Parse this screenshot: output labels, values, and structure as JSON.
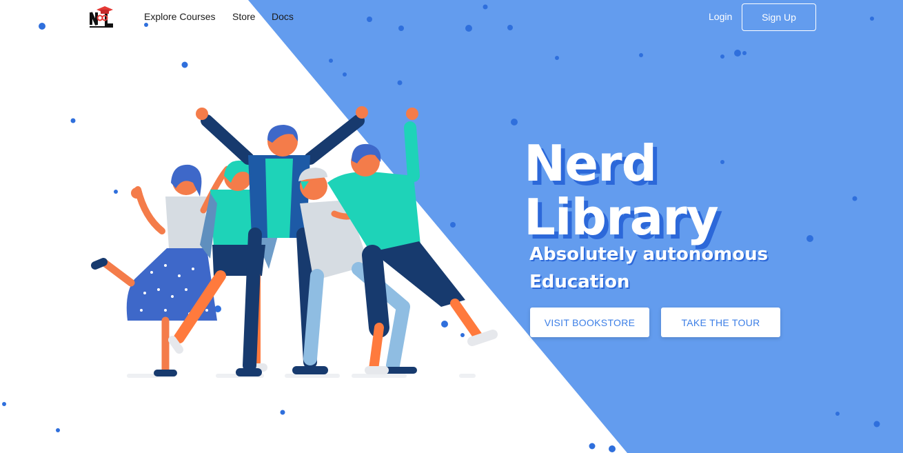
{
  "colors": {
    "hero_blue": "#639cee",
    "accent_blue": "#2c68d9",
    "dot_blue": "#2f6fdc",
    "teal": "#22d3b5",
    "navy": "#173a6e",
    "orange": "#ff7a3d"
  },
  "header": {
    "logo_icon": "nerd-library-logo",
    "nav": {
      "explore": "Explore Courses",
      "store": "Store",
      "docs": "Docs"
    },
    "login": "Login",
    "signup": "Sign Up"
  },
  "hero": {
    "title_line1": "Nerd",
    "title_line2": "Library",
    "subtitle_line1": "Absolutely autonomous",
    "subtitle_line2": "Education",
    "cta_bookstore": "VISIT BOOKSTORE",
    "cta_tour": "TAKE THE TOUR",
    "illustration_icon": "happy-students-illustration"
  }
}
